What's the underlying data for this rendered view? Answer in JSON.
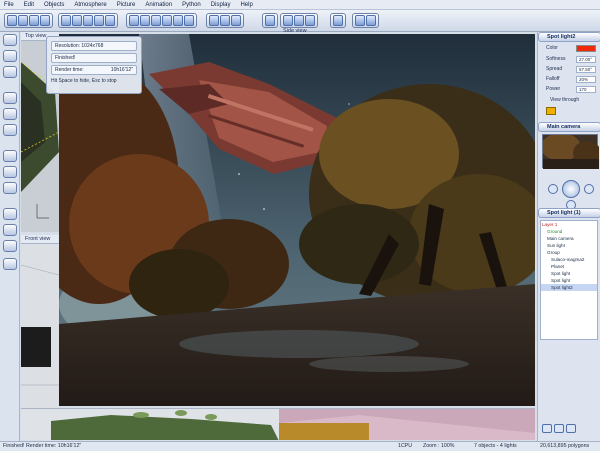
{
  "menu": [
    "File",
    "Edit",
    "Objects",
    "Atmosphere",
    "Picture",
    "Animation",
    "Python",
    "Display",
    "Help"
  ],
  "views": {
    "top": "Top view",
    "side": "Side view",
    "front": "Front view"
  },
  "render_info": {
    "resolution": "Resolution: 1024x768",
    "state": "Finished!",
    "time_label": "Render time:",
    "time_value": "10h16'12\"",
    "hint": "Hit Space to hide, Esc to stop"
  },
  "light_panel": {
    "title": "Spot light2",
    "color_label": "Color",
    "color": "#ee2a0a",
    "softness_label": "Softness",
    "softness": "27.00°",
    "spread_label": "Spread",
    "spread": "57.50°",
    "falloff_label": "Falloff",
    "falloff": "20%",
    "power_label": "Power",
    "power": "170",
    "view_through": "View through",
    "swatch_color": "#f0b000"
  },
  "camera_panel": {
    "title": "Main camera"
  },
  "objects_panel": {
    "title": "Spot light (1)",
    "tree": [
      "Layer 1",
      "Ground",
      "Main camera",
      "Sun light",
      "Group",
      "Sulaco-magma2",
      "Planet",
      "Spot light",
      "Spot light",
      "Spot light2"
    ]
  },
  "status": {
    "left": "Finished! Render time: 10h16'12\"",
    "cpu": "1CPU",
    "zoom": "Zoom : 100%",
    "objects": "7 objects - 4 lights",
    "polygons": "20,613,895 polygons"
  }
}
